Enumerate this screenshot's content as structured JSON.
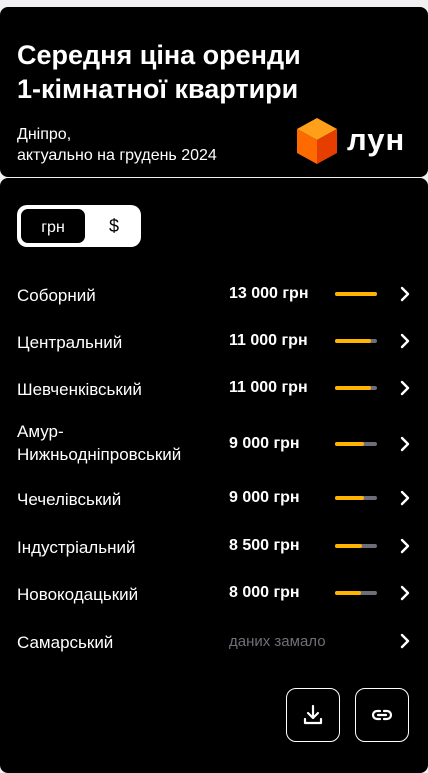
{
  "header": {
    "title_line1": "Середня ціна оренди",
    "title_line2": "1-кімнатної квартири",
    "city": "Дніпро,",
    "updated": "актуально на грудень 2024",
    "logo_text": "лун",
    "logo_icon": "orange-cube-icon"
  },
  "currency_toggle": {
    "active": "грн",
    "inactive": "$"
  },
  "colors": {
    "accent": "#ffb400",
    "track": "#6e6e78",
    "background": "#000000",
    "muted_text": "#6f6f78"
  },
  "districts": [
    {
      "name": "Соборний",
      "price": "13 000 грн",
      "level": 1.0
    },
    {
      "name": "Центральний",
      "price": "11 000 грн",
      "level": 0.85
    },
    {
      "name": "Шевченківський",
      "price": "11 000 грн",
      "level": 0.85
    },
    {
      "name_line1": "Амур-",
      "name_line2": "Нижньодніпровський",
      "price": "9 000 грн",
      "level": 0.69
    },
    {
      "name": "Чечелівський",
      "price": "9 000 грн",
      "level": 0.69
    },
    {
      "name": "Індустріальний",
      "price": "8 500 грн",
      "level": 0.65
    },
    {
      "name": "Новокодацький",
      "price": "8 000 грн",
      "level": 0.62
    },
    {
      "name": "Самарський",
      "nodata": "даних замало"
    }
  ],
  "actions": {
    "download_icon": "download-icon",
    "link_icon": "link-icon"
  }
}
